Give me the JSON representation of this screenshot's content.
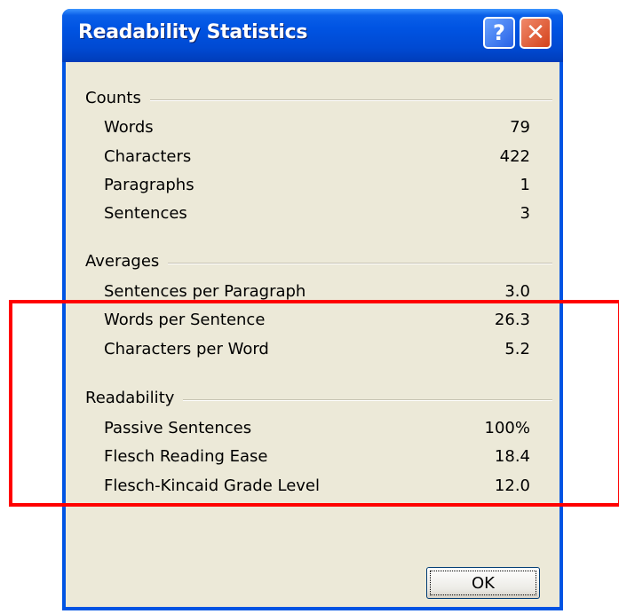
{
  "window": {
    "title": "Readability Statistics",
    "help_glyph": "?",
    "close_glyph": "✕"
  },
  "groups": {
    "counts": {
      "label": "Counts",
      "rows": [
        {
          "label": "Words",
          "value": "79"
        },
        {
          "label": "Characters",
          "value": "422"
        },
        {
          "label": "Paragraphs",
          "value": "1"
        },
        {
          "label": "Sentences",
          "value": "3"
        }
      ]
    },
    "averages": {
      "label": "Averages",
      "rows": [
        {
          "label": "Sentences per Paragraph",
          "value": "3.0"
        },
        {
          "label": "Words per Sentence",
          "value": "26.3"
        },
        {
          "label": "Characters per Word",
          "value": "5.2"
        }
      ]
    },
    "readability": {
      "label": "Readability",
      "rows": [
        {
          "label": "Passive Sentences",
          "value": "100%"
        },
        {
          "label": "Flesch Reading Ease",
          "value": "18.4"
        },
        {
          "label": "Flesch-Kincaid Grade Level",
          "value": "12.0"
        }
      ]
    }
  },
  "buttons": {
    "ok_label": "OK"
  },
  "colors": {
    "titlebar": "#0054e3",
    "dialog_bg": "#ece9d8",
    "highlight": "#ff0000"
  }
}
